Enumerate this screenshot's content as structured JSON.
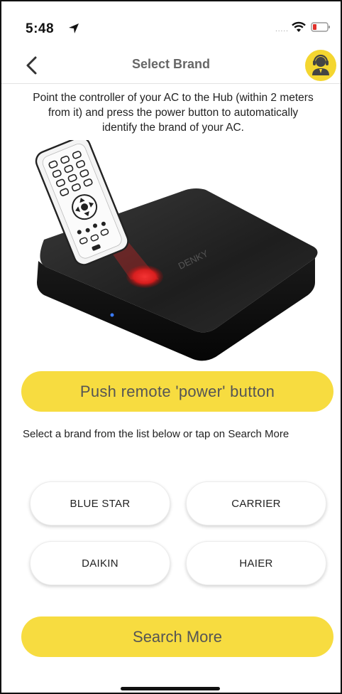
{
  "status_bar": {
    "time": "5:48",
    "signal_dots": "....."
  },
  "nav": {
    "title": "Select Brand"
  },
  "instructions": "Point the controller of your AC to the Hub (within 2 meters from it) and press the power button to automatically identify the brand of your AC.",
  "illustration": {
    "device_label": "DENKY"
  },
  "push_remote_label": "Push remote 'power' button",
  "select_hint": "Select a brand from the list below or tap on Search More",
  "brands": [
    "BLUE STAR",
    "CARRIER",
    "DAIKIN",
    "HAIER"
  ],
  "search_more_label": "Search More",
  "colors": {
    "accent": "#f7dc40",
    "text": "#222222",
    "title": "#666666"
  },
  "icons": {
    "back": "chevron-left-icon",
    "support": "support-agent-icon",
    "location": "location-arrow-icon",
    "wifi": "wifi-icon",
    "battery": "battery-icon"
  }
}
